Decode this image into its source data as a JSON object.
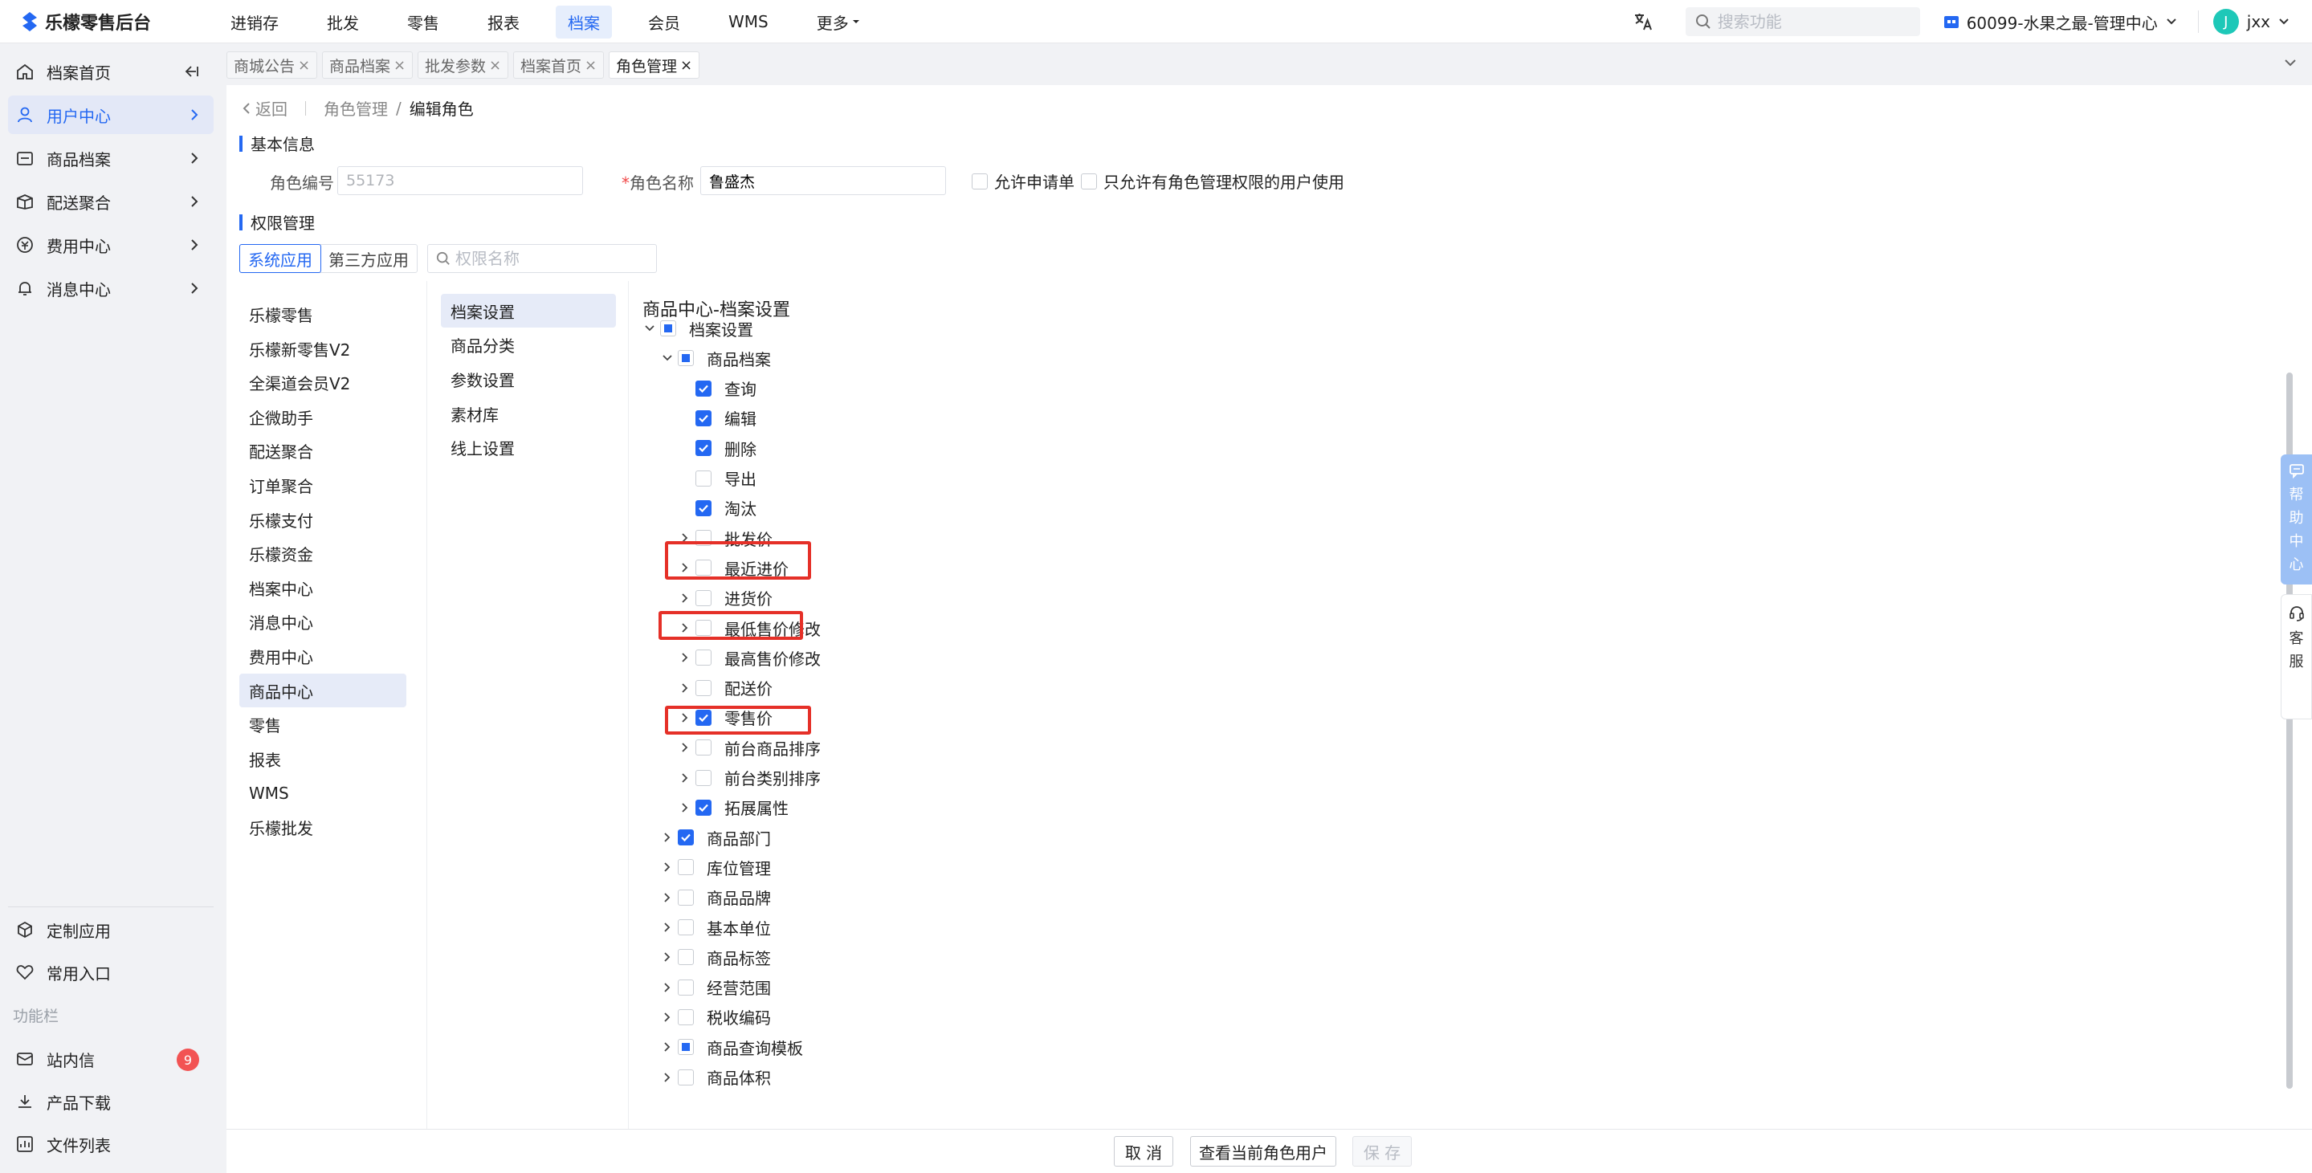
{
  "app": {
    "title": "乐檬零售后台"
  },
  "topnav": {
    "items": [
      "进销存",
      "批发",
      "零售",
      "报表",
      "档案",
      "会员",
      "WMS"
    ],
    "more": "更多",
    "active_index": 4
  },
  "topright": {
    "search_placeholder": "搜索功能",
    "store": "60099-水果之最-管理中心",
    "user_initial": "J",
    "user_name": "jxx"
  },
  "sidebar": {
    "items": [
      "档案首页",
      "用户中心",
      "商品档案",
      "配送聚合",
      "费用中心",
      "消息中心"
    ],
    "active_index": 1,
    "bottom_items": [
      "定制应用",
      "常用入口"
    ],
    "section_title": "功能栏",
    "func_items": [
      "站内信",
      "产品下载",
      "文件列表"
    ],
    "unread_count": "9"
  },
  "tabs": {
    "items": [
      "商城公告",
      "商品档案",
      "批发参数",
      "档案首页",
      "角色管理"
    ],
    "active_index": 4,
    "close_glyph": "×"
  },
  "breadcrumb": {
    "back": "返回",
    "crumb1": "角色管理",
    "slash": "/",
    "crumb2": "编辑角色"
  },
  "basic": {
    "section_title": "基本信息",
    "code_label": "角色编号",
    "code_value": "55173",
    "name_required_mark": "*",
    "name_label": "角色名称",
    "name_value": "鲁盛杰",
    "opt_allow_apply": "允许申请单",
    "opt_only_admin": "只允许有角色管理权限的用户使用"
  },
  "perm": {
    "section_title": "权限管理",
    "seg_system": "系统应用",
    "seg_third": "第三方应用",
    "search_placeholder": "权限名称",
    "apps": [
      "乐檬零售",
      "乐檬新零售V2",
      "全渠道会员V2",
      "企微助手",
      "配送聚合",
      "订单聚合",
      "乐檬支付",
      "乐檬资金",
      "档案中心",
      "消息中心",
      "费用中心",
      "商品中心",
      "零售",
      "报表",
      "WMS",
      "乐檬批发"
    ],
    "apps_active_index": 11,
    "modules": [
      "档案设置",
      "商品分类",
      "参数设置",
      "素材库",
      "线上设置"
    ],
    "modules_active_index": 0,
    "tree_title": "商品中心-档案设置",
    "tree": {
      "root": "档案设置",
      "group": "商品档案",
      "leaves": [
        {
          "label": "查询",
          "checked": true,
          "expandable": false
        },
        {
          "label": "编辑",
          "checked": true,
          "expandable": false
        },
        {
          "label": "删除",
          "checked": true,
          "expandable": false
        },
        {
          "label": "导出",
          "checked": false,
          "expandable": false
        },
        {
          "label": "淘汰",
          "checked": true,
          "expandable": false
        },
        {
          "label": "批发价",
          "checked": false,
          "expandable": true
        },
        {
          "label": "最近进价",
          "checked": false,
          "expandable": true
        },
        {
          "label": "进货价",
          "checked": false,
          "expandable": true
        },
        {
          "label": "最低售价修改",
          "checked": false,
          "expandable": true
        },
        {
          "label": "最高售价修改",
          "checked": false,
          "expandable": true
        },
        {
          "label": "配送价",
          "checked": false,
          "expandable": true
        },
        {
          "label": "零售价",
          "checked": true,
          "expandable": true
        },
        {
          "label": "前台商品排序",
          "checked": false,
          "expandable": true
        },
        {
          "label": "前台类别排序",
          "checked": false,
          "expandable": true
        },
        {
          "label": "拓展属性",
          "checked": true,
          "expandable": true
        }
      ],
      "siblings": [
        {
          "label": "商品部门",
          "state": "checked"
        },
        {
          "label": "库位管理",
          "state": "unchecked"
        },
        {
          "label": "商品品牌",
          "state": "unchecked"
        },
        {
          "label": "基本单位",
          "state": "unchecked"
        },
        {
          "label": "商品标签",
          "state": "unchecked"
        },
        {
          "label": "经营范围",
          "state": "unchecked"
        },
        {
          "label": "税收编码",
          "state": "unchecked"
        },
        {
          "label": "商品查询模板",
          "state": "partial"
        },
        {
          "label": "商品体积",
          "state": "unchecked"
        }
      ]
    }
  },
  "footer": {
    "cancel": "取 消",
    "view_users": "查看当前角色用户",
    "save": "保 存"
  },
  "float": {
    "help_chars": [
      "帮",
      "助",
      "中",
      "心"
    ],
    "service_chars": [
      "客",
      "服"
    ]
  },
  "colors": {
    "accent": "#2468f2",
    "highlight": "#e53028",
    "badge": "#f25353",
    "avatar": "#1ec8b8"
  }
}
